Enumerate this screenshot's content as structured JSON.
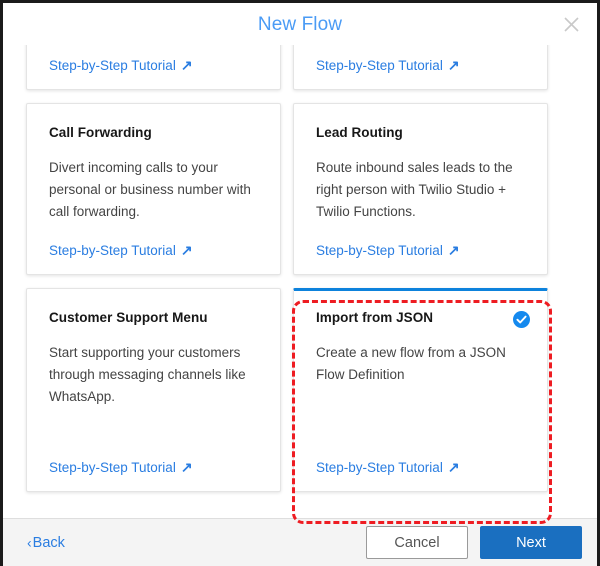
{
  "window": {
    "title": "New Flow",
    "close_icon": "close-icon",
    "title_color": "#4a9bf5"
  },
  "cards": [
    {
      "id": "card-row0-left",
      "row": 0,
      "title": "",
      "description": "",
      "link_label": "Step-by-Step Tutorial",
      "link_icon": "external-link-arrow-icon",
      "selected": false,
      "clipped": true
    },
    {
      "id": "card-row0-right",
      "row": 0,
      "title": "",
      "description": "",
      "link_label": "Step-by-Step Tutorial",
      "link_icon": "external-link-arrow-icon",
      "selected": false,
      "clipped": true
    },
    {
      "id": "card-call-forwarding",
      "row": 1,
      "title": "Call Forwarding",
      "description": "Divert incoming calls to your personal or business number with call forwarding.",
      "link_label": "Step-by-Step Tutorial",
      "link_icon": "external-link-arrow-icon",
      "selected": false,
      "clipped": false
    },
    {
      "id": "card-lead-routing",
      "row": 1,
      "title": "Lead Routing",
      "description": "Route inbound sales leads to the right person with Twilio Studio + Twilio Functions.",
      "link_label": "Step-by-Step Tutorial",
      "link_icon": "external-link-arrow-icon",
      "selected": false,
      "clipped": false
    },
    {
      "id": "card-customer-support-menu",
      "row": 2,
      "title": "Customer Support Menu",
      "description": "Start supporting your customers through messaging channels like WhatsApp.",
      "link_label": "Step-by-Step Tutorial",
      "link_icon": "external-link-arrow-icon",
      "selected": false,
      "clipped": false
    },
    {
      "id": "card-import-from-json",
      "row": 2,
      "title": "Import from JSON",
      "description": "Create a new flow from a JSON Flow Definition",
      "link_label": "Step-by-Step Tutorial",
      "link_icon": "external-link-arrow-icon",
      "selected": true,
      "selected_icon": "check-circle-icon",
      "selected_accent": "#0d82dc",
      "clipped": false
    }
  ],
  "footer": {
    "back_label": "Back",
    "back_icon": "chevron-left-icon",
    "cancel_label": "Cancel",
    "next_label": "Next",
    "next_color": "#1a6fc0"
  },
  "annotation": {
    "highlight_target": "card-import-from-json",
    "color": "#ee1c22",
    "style": "dashed-rounded-rectangle"
  }
}
